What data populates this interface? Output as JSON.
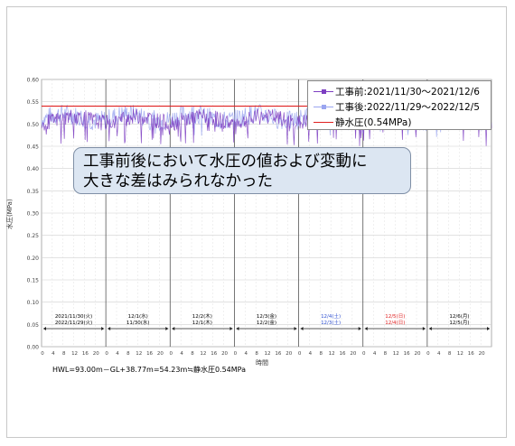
{
  "chart_data": {
    "type": "line",
    "ylabel": "水圧(MPa)",
    "xlabel": "時間",
    "ylim": [
      0,
      0.6
    ],
    "yticks": [
      "0.00",
      "0.05",
      "0.10",
      "0.15",
      "0.20",
      "0.25",
      "0.30",
      "0.35",
      "0.40",
      "0.45",
      "0.50",
      "0.55",
      "0.60"
    ],
    "hour_ticks": [
      "0",
      "4",
      "8",
      "12",
      "16",
      "20"
    ],
    "days": [
      {
        "top": "2021/11/30(火)",
        "bottom": "2022/11/29(火)",
        "color": "#000000"
      },
      {
        "top": "12/1(水)",
        "bottom": "11/30(水)",
        "color": "#000000"
      },
      {
        "top": "12/2(木)",
        "bottom": "12/1(木)",
        "color": "#000000"
      },
      {
        "top": "12/3(金)",
        "bottom": "12/2(金)",
        "color": "#000000"
      },
      {
        "top": "12/4(土)",
        "bottom": "12/3(土)",
        "color": "#2f50d0"
      },
      {
        "top": "12/5(日)",
        "bottom": "12/4(日)",
        "color": "#e02020"
      },
      {
        "top": "12/6(月)",
        "bottom": "12/5(月)",
        "color": "#000000"
      }
    ],
    "series": [
      {
        "name": "工事前:2021/11/30～2021/12/6",
        "color": "#7d3fc2",
        "typical_range": [
          0.49,
          0.53
        ],
        "min_spike": 0.45
      },
      {
        "name": "工事後:2022/11/29～2022/12/5",
        "color": "#9aa5f0",
        "typical_range": [
          0.49,
          0.54
        ],
        "min_spike": 0.47
      },
      {
        "name": "静水圧(0.54MPa)",
        "color": "#e02020",
        "values": [
          0.54
        ]
      }
    ],
    "grid": true,
    "legend_position": "top-right"
  },
  "callout": {
    "line1": "工事前後において水圧の値および変動に",
    "line2": "大きな差はみられなかった"
  },
  "footnote": "HWL=93.00m－GL+38.77m=54.23m≒静水圧0.54MPa"
}
